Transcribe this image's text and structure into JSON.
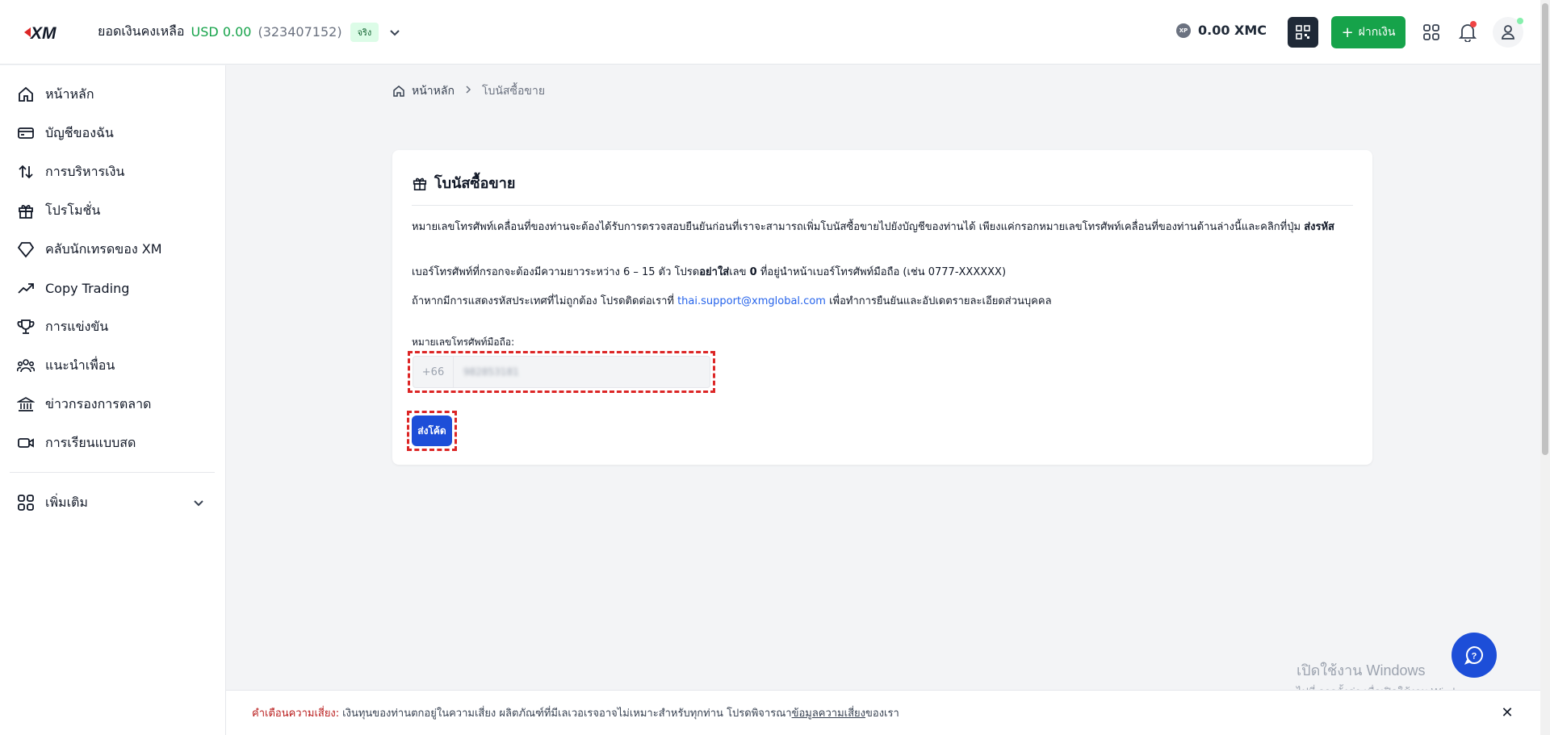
{
  "header": {
    "logo_text": "XM",
    "balance_label": "ยอดเงินคงเหลือ",
    "balance_amount": "USD 0.00",
    "account_number": "(323407152)",
    "account_type": "จริง",
    "xmc_amount": "0.00 XMC",
    "xmc_coin_label": "XP",
    "deposit_label": "ฝากเงิน"
  },
  "sidebar": {
    "items": [
      {
        "label": "หน้าหลัก",
        "icon": "home-icon"
      },
      {
        "label": "บัญชีของฉัน",
        "icon": "card-icon"
      },
      {
        "label": "การบริหารเงิน",
        "icon": "transfer-icon"
      },
      {
        "label": "โปรโมชั่น",
        "icon": "gift-icon"
      },
      {
        "label": "คลับนักเทรดของ XM",
        "icon": "diamond-icon"
      },
      {
        "label": "Copy Trading",
        "icon": "trend-icon"
      },
      {
        "label": "การแข่งขัน",
        "icon": "trophy-icon"
      },
      {
        "label": "แนะนำเพื่อน",
        "icon": "users-icon"
      },
      {
        "label": "ข่าวกรองการตลาด",
        "icon": "bank-icon"
      },
      {
        "label": "การเรียนแบบสด",
        "icon": "video-icon"
      }
    ],
    "more_label": "เพิ่มเติม"
  },
  "breadcrumb": {
    "home": "หน้าหลัก",
    "current": "โบนัสซื้อขาย"
  },
  "card": {
    "title": "โบนัสซื้อขาย",
    "p1_text": "หมายเลขโทรศัพท์เคลื่อนที่ของท่านจะต้องได้รับการตรวจสอบยืนยันก่อนที่เราจะสามารถเพิ่มโบนัสซื้อขายไปยังบัญชีของท่านได้ เพียงแค่กรอกหมายเลขโทรศัพท์เคลื่อนที่ของท่านด้านล่างนี้และคลิกที่ปุ่ม ",
    "p1_bold": "ส่งรหัส",
    "p2_a": "เบอร์โทรศัพท์ที่กรอกจะต้องมีความยาวระหว่าง 6 – 15 ตัว โปรด",
    "p2_bold1": "อย่าใส่",
    "p2_b": "เลข ",
    "p2_bold2": "0",
    "p2_c": " ที่อยู่นำหน้าเบอร์โทรศัพท์มือถือ (เช่น 0777-XXXXXX)",
    "p3_a": "ถ้าหากมีการแสดงรหัสประเทศที่ไม่ถูกต้อง โปรดติดต่อเราที่ ",
    "p3_link": "thai.support@xmglobal.com",
    "p3_b": " เพื่อทำการยืนยันและอัปเดตรายละเอียดส่วนบุคคล",
    "phone_label": "หมายเลขโทรศัพท์มือถือ:",
    "phone_prefix": "+66",
    "phone_value": "982853181",
    "submit_label": "ส่งโค้ด"
  },
  "watermark": {
    "line1": "เปิดใช้งาน Windows",
    "line2": "ไปที่ การตั้งค่า เพื่อเปิดใช้งาน Windows"
  },
  "risk": {
    "label": "คำเตือนความเสี่ยง:",
    "text": "เงินทุนของท่านตกอยู่ในความเสี่ยง ผลิตภัณฑ์ที่มีเลเวอเรจอาจไม่เหมาะสำหรับทุกท่าน โปรดพิจารณา",
    "link": "ข้อมูลความเสี่ยง",
    "suffix": "ของเรา"
  },
  "colors": {
    "brand_red": "#dc2626",
    "green": "#16a34a",
    "blue": "#1d4ed8"
  }
}
